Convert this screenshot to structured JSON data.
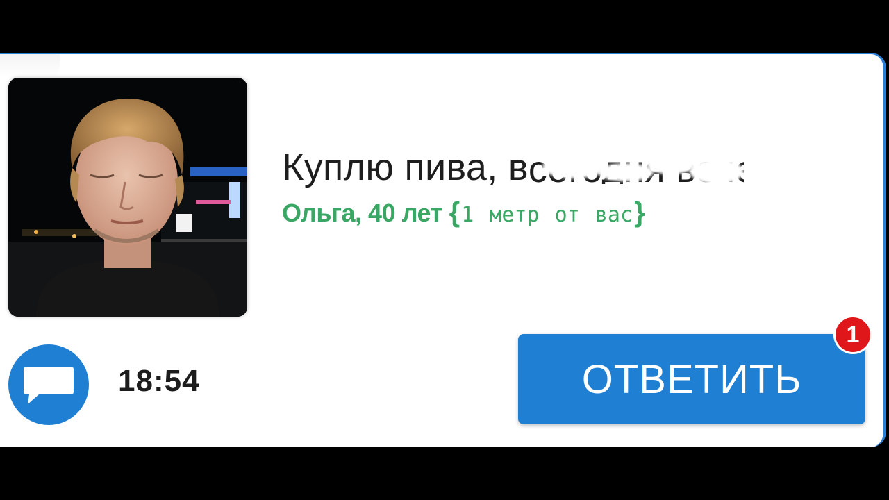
{
  "message": {
    "headline_visible": "Куплю пива, в",
    "headline_obscured": "сегодня вечер",
    "sender_name": "Ольга, 40 лет",
    "distance_open": "{",
    "distance": "1 метр от вас",
    "distance_close": "}",
    "time": "18:54"
  },
  "actions": {
    "reply_label": "ОТВЕТИТЬ",
    "unread_count": "1"
  },
  "icons": {
    "chat": "chat-bubble-icon",
    "avatar": "avatar-photo"
  },
  "colors": {
    "accent_blue": "#1f7fd3",
    "name_green": "#3aa864",
    "badge_red": "#e0171a"
  }
}
